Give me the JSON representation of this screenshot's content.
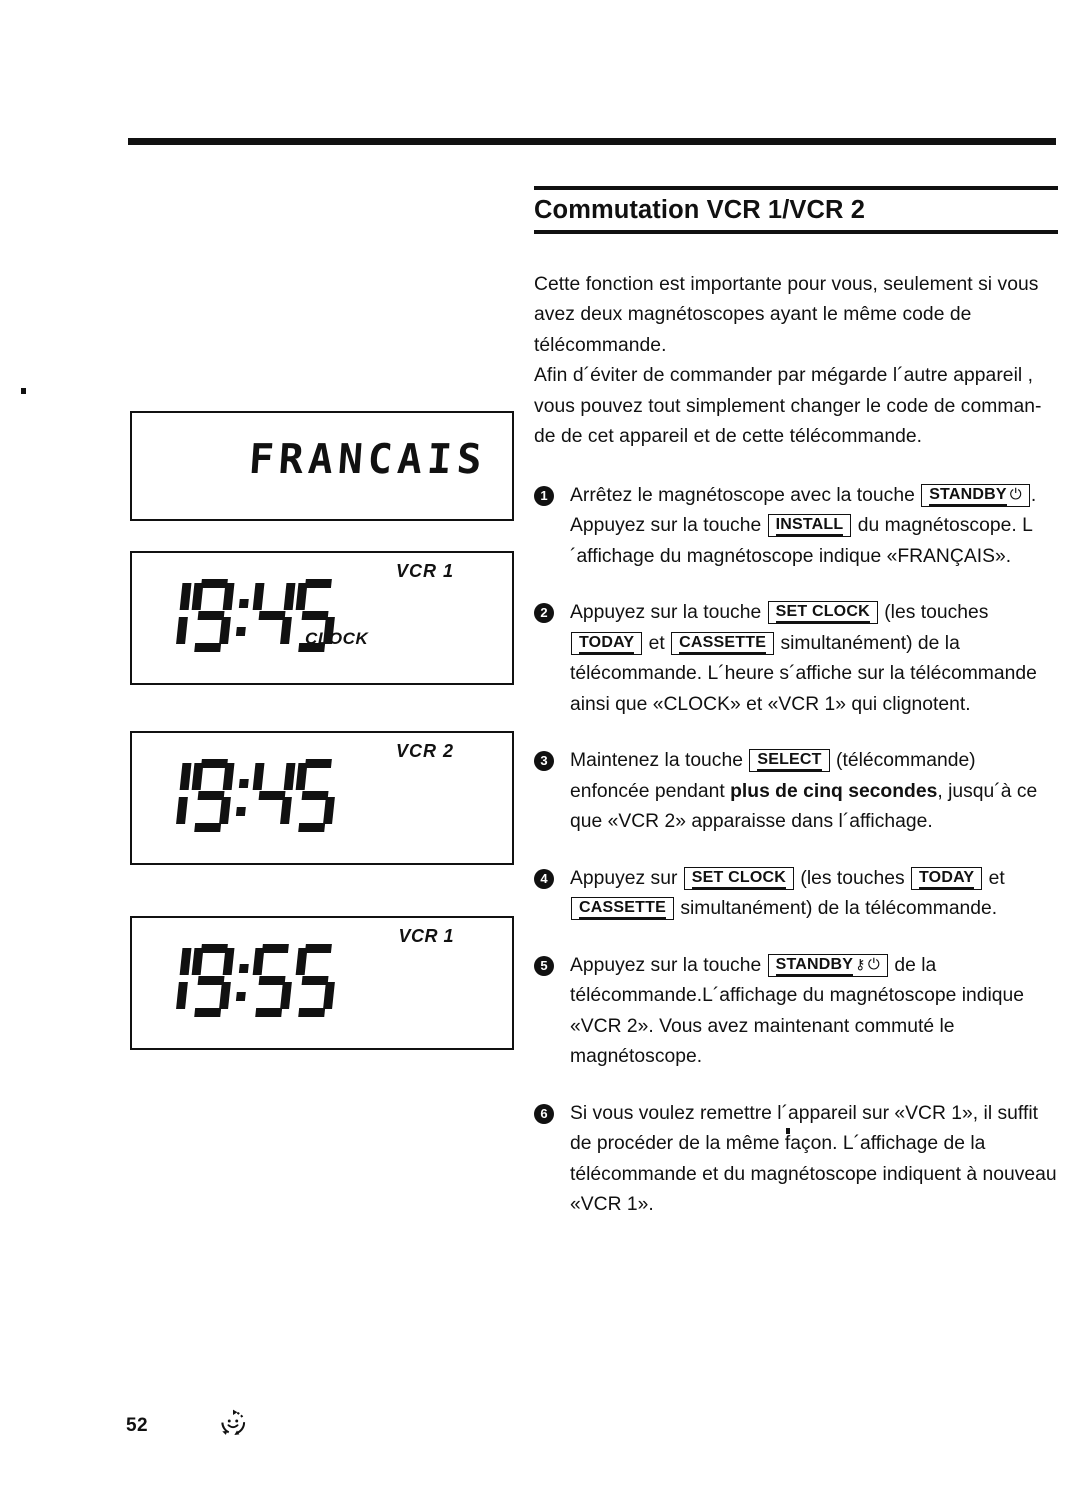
{
  "page": {
    "number": "52",
    "logo_icon": "recycle-smiley-logo"
  },
  "heading": {
    "title": "Commutation VCR 1/VCR 2"
  },
  "intro": {
    "line1": "Cette fonction est importante pour vous, seulement si vous",
    "line2": "avez deux magnétoscopes ayant le même code de",
    "line3": "télécommande.",
    "line4": "Afin d´éviter de commander par mégarde l´autre appareil ,",
    "line5": "vous pouvez tout simplement changer le code de comman-",
    "line6": "de de cet appareil et de cette télécommande."
  },
  "keys": {
    "standby": "STANDBY",
    "standby_power_glyph": "⏻",
    "standby_key_glyph": "⚷",
    "install": "INSTALL",
    "set_clock": "SET CLOCK",
    "today": "TODAY",
    "cassette": "CASSETTE",
    "select": "SELECT"
  },
  "steps": [
    {
      "num": "1",
      "t1": "Arrêtez le magnétoscope avec la touche ",
      "t2": ". Appuyez sur la touche ",
      "t3": " du magnétoscope. L´affichage du magnétoscope indique «FRANÇAIS»."
    },
    {
      "num": "2",
      "t1": "Appuyez sur la touche ",
      "t2": " (les touches ",
      "t3": " et ",
      "t4": " simultanément) de la télécommande. L´heure s´affiche sur la télécommande ainsi que «CLOCK» et «VCR 1» qui clignotent."
    },
    {
      "num": "3",
      "t1": "Maintenez la touche ",
      "t2": " (télécommande) enfoncée pendant ",
      "bold": "plus de cinq secondes",
      "t3": ", jusqu´à ce que «VCR 2» apparaisse dans l´affichage."
    },
    {
      "num": "4",
      "t1": "Appuyez sur ",
      "t2": " (les touches ",
      "t3": " et ",
      "t4": " simultanément) de la télécommande."
    },
    {
      "num": "5",
      "t1": "Appuyez sur la touche ",
      "t2": " de la télécommande.L´affichage du magnétoscope indique «VCR 2». Vous avez maintenant commuté le magnétoscope."
    },
    {
      "num": "6",
      "t1": "Si vous voulez remettre l´appareil sur «VCR 1», il suffit de procéder de la même façon. L´affichage de la télécommande et du magnétoscope indiquent à nouveau «VCR 1»."
    }
  ],
  "displays": [
    {
      "id": "francais",
      "segment_text": "FRANCAIS"
    },
    {
      "id": "clock",
      "time": "19:45",
      "vcr_label": "VCR  1",
      "mode_label": "CLOCK"
    },
    {
      "id": "vcr2",
      "time": "19:45",
      "vcr_label": "VCR  2"
    },
    {
      "id": "vcr1",
      "time": "19:55",
      "vcr_label": "VCR 1"
    }
  ]
}
